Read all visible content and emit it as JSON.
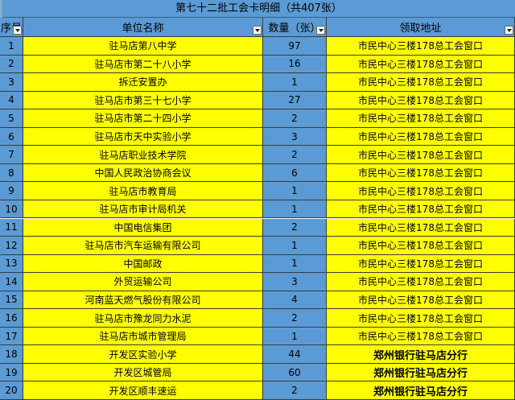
{
  "sheet": {
    "title": "第七十二批工会卡明细（共407张）",
    "headers": {
      "num": "序号",
      "unit": "单位名称",
      "qty": "数量（张）",
      "addr": "领取地址"
    },
    "rows": [
      {
        "num": "1",
        "unit": "驻马店第八中学",
        "qty": "97",
        "addr": "市民中心三楼178总工会窗口"
      },
      {
        "num": "2",
        "unit": "驻马店市第二十八小学",
        "qty": "16",
        "addr": "市民中心三楼178总工会窗口"
      },
      {
        "num": "3",
        "unit": "拆迁安置办",
        "qty": "1",
        "addr": "市民中心三楼178总工会窗口"
      },
      {
        "num": "4",
        "unit": "驻马店市第三十七小学",
        "qty": "27",
        "addr": "市民中心三楼178总工会窗口"
      },
      {
        "num": "5",
        "unit": "驻马店市第二十四小学",
        "qty": "2",
        "addr": "市民中心三楼178总工会窗口"
      },
      {
        "num": "6",
        "unit": "驻马店市天中实验小学",
        "qty": "3",
        "addr": "市民中心三楼178总工会窗口"
      },
      {
        "num": "7",
        "unit": "驻马店职业技术学院",
        "qty": "2",
        "addr": "市民中心三楼178总工会窗口"
      },
      {
        "num": "8",
        "unit": "中国人民政治协商会议",
        "qty": "6",
        "addr": "市民中心三楼178总工会窗口"
      },
      {
        "num": "9",
        "unit": "驻马店市教育局",
        "qty": "1",
        "addr": "市民中心三楼178总工会窗口"
      },
      {
        "num": "10",
        "unit": "驻马店市审计局机关",
        "qty": "1",
        "addr": "市民中心三楼178总工会窗口"
      },
      {
        "num": "11",
        "unit": "中国电信集团",
        "qty": "2",
        "addr": "市民中心三楼178总工会窗口"
      },
      {
        "num": "12",
        "unit": "驻马店市汽车运输有限公司",
        "qty": "1",
        "addr": "市民中心三楼178总工会窗口"
      },
      {
        "num": "13",
        "unit": "中国邮政",
        "qty": "1",
        "addr": "市民中心三楼178总工会窗口"
      },
      {
        "num": "14",
        "unit": "外贸运输公司",
        "qty": "3",
        "addr": "市民中心三楼178总工会窗口"
      },
      {
        "num": "15",
        "unit": "河南蓝天燃气股份有限公司",
        "qty": "4",
        "addr": "市民中心三楼178总工会窗口"
      },
      {
        "num": "16",
        "unit": "驻马店市豫龙同力水泥",
        "qty": "2",
        "addr": "市民中心三楼178总工会窗口"
      },
      {
        "num": "17",
        "unit": "驻马店市城市管理局",
        "qty": "1",
        "addr": "市民中心三楼178总工会窗口"
      },
      {
        "num": "18",
        "unit": "开发区实验小学",
        "qty": "44",
        "addr": "郑州银行驻马店分行"
      },
      {
        "num": "19",
        "unit": "开发区城管局",
        "qty": "60",
        "addr": "郑州银行驻马店分行"
      },
      {
        "num": "20",
        "unit": "开发区顺丰速运",
        "qty": "2",
        "addr": "郑州银行驻马店分行"
      }
    ]
  },
  "colors": {
    "header_blue": "#5b9bd5",
    "row_yellow": "#ffff00"
  },
  "icons": {
    "filter": "dropdown-arrow-icon"
  }
}
